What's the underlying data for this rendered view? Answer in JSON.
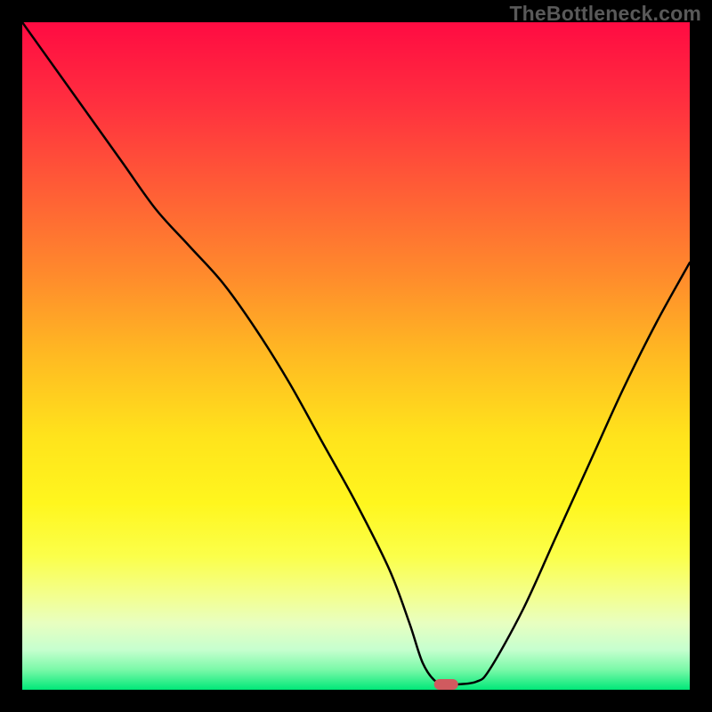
{
  "watermark": "TheBottleneck.com",
  "chart_data": {
    "type": "line",
    "title": "",
    "xlabel": "",
    "ylabel": "",
    "xlim": [
      0,
      100
    ],
    "ylim": [
      0,
      100
    ],
    "grid": false,
    "series": [
      {
        "name": "bottleneck-curve",
        "x": [
          0,
          5,
          10,
          15,
          20,
          25,
          30,
          35,
          40,
          45,
          50,
          55,
          58,
          60,
          62,
          64,
          65,
          68,
          70,
          75,
          80,
          85,
          90,
          95,
          100
        ],
        "y": [
          100,
          93,
          86,
          79,
          72,
          66.5,
          61,
          54,
          46,
          37,
          28,
          18,
          10,
          4,
          1.2,
          0.8,
          0.8,
          1.2,
          3,
          12,
          23,
          34,
          45,
          55,
          64
        ]
      }
    ],
    "marker": {
      "name": "optimal-point",
      "x": 63.5,
      "y": 0.8,
      "color": "#d05a5f",
      "width": 3.6,
      "height": 1.6
    },
    "gradient_stops": [
      {
        "offset": 0,
        "color": "#ff0b42"
      },
      {
        "offset": 12,
        "color": "#ff2f3f"
      },
      {
        "offset": 25,
        "color": "#ff5d36"
      },
      {
        "offset": 38,
        "color": "#ff8b2c"
      },
      {
        "offset": 50,
        "color": "#ffba22"
      },
      {
        "offset": 62,
        "color": "#ffe31c"
      },
      {
        "offset": 72,
        "color": "#fff61e"
      },
      {
        "offset": 80,
        "color": "#fbff4a"
      },
      {
        "offset": 86,
        "color": "#f3ff90"
      },
      {
        "offset": 90,
        "color": "#e8ffc0"
      },
      {
        "offset": 94,
        "color": "#c6ffcf"
      },
      {
        "offset": 97,
        "color": "#7af9a8"
      },
      {
        "offset": 100,
        "color": "#00e878"
      }
    ],
    "curve_color": "#000000",
    "curve_width": 2.5
  }
}
